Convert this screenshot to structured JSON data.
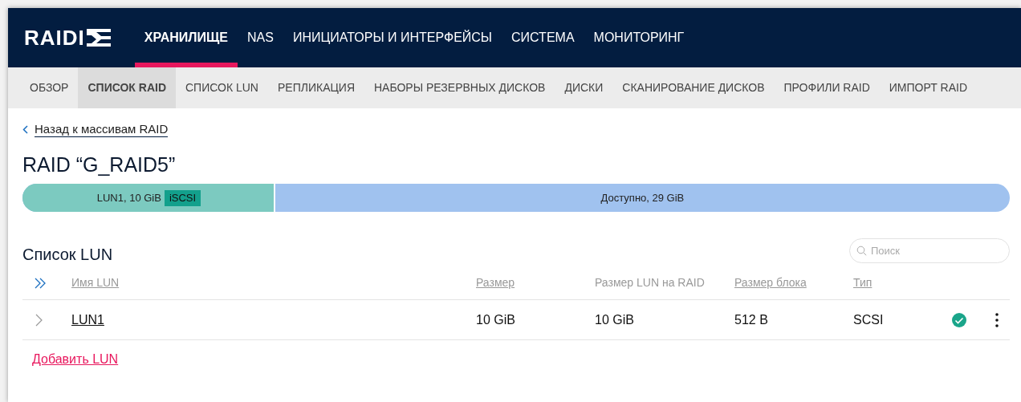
{
  "logo": {
    "text": "RAIDI"
  },
  "main_nav": [
    {
      "label": "ХРАНИЛИЩЕ",
      "selected": true
    },
    {
      "label": "NAS",
      "selected": false
    },
    {
      "label": "ИНИЦИАТОРЫ И ИНТЕРФЕЙСЫ",
      "selected": false
    },
    {
      "label": "СИСТЕМА",
      "selected": false
    },
    {
      "label": "МОНИТОРИНГ",
      "selected": false
    }
  ],
  "sub_nav": [
    {
      "label": "ОБЗОР",
      "selected": false
    },
    {
      "label": "СПИСОК RAID",
      "selected": true
    },
    {
      "label": "СПИСОК LUN",
      "selected": false
    },
    {
      "label": "РЕПЛИКАЦИЯ",
      "selected": false
    },
    {
      "label": "НАБОРЫ РЕЗЕРВНЫХ ДИСКОВ",
      "selected": false
    },
    {
      "label": "ДИСКИ",
      "selected": false
    },
    {
      "label": "СКАНИРОВАНИЕ ДИСКОВ",
      "selected": false
    },
    {
      "label": "ПРОФИЛИ RAID",
      "selected": false
    },
    {
      "label": "ИМПОРТ RAID",
      "selected": false
    }
  ],
  "back_link": "Назад к массивам RAID",
  "title": "RAID “G_RAID5”",
  "capacity_bar": {
    "lun_segment": {
      "label": "LUN1, 10 GiB",
      "tag": "iSCSI",
      "level": 0.256
    },
    "free_segment": {
      "label": "Доступно, 29 GiB"
    }
  },
  "lun_list": {
    "title": "Список LUN",
    "search": {
      "placeholder": "Поиск"
    },
    "columns": [
      {
        "label": "Имя LUN",
        "sortable": true
      },
      {
        "label": "Размер",
        "sortable": true
      },
      {
        "label": "Размер LUN на RAID",
        "sortable": false
      },
      {
        "label": "Размер блока",
        "sortable": true
      },
      {
        "label": "Тип",
        "sortable": true
      }
    ],
    "rows": [
      {
        "expanded": false,
        "cells": [
          "LUN1",
          "10 GiB",
          "10 GiB",
          "512 B",
          "SCSI"
        ],
        "healthy": true
      }
    ],
    "add_link": "Добавить LUN"
  }
}
